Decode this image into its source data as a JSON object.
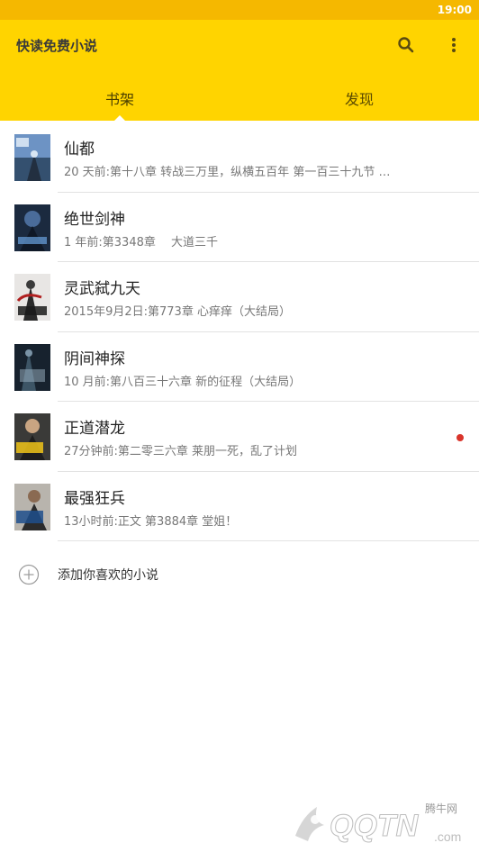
{
  "status_bar": {
    "time": "19:00"
  },
  "app": {
    "title": "快读免费小说",
    "search_icon": "search-icon",
    "more_icon": "more-vert-icon",
    "accent": "#ffd400",
    "status_color": "#f5b800"
  },
  "tabs": [
    {
      "label": "书架",
      "active": true
    },
    {
      "label": "发现",
      "active": false
    }
  ],
  "books": [
    {
      "title": "仙都",
      "subtitle": "20 天前:第十八章 转战三万里，纵横五百年 第一百三十九节 …",
      "has_update": false
    },
    {
      "title": "绝世剑神",
      "subtitle": "1 年前:第3348章　 大道三千",
      "has_update": false
    },
    {
      "title": "灵武弑九天",
      "subtitle": "2015年9月2日:第773章 心痒痒（大结局）",
      "has_update": false
    },
    {
      "title": "阴间神探",
      "subtitle": "10 月前:第八百三十六章 新的征程（大结局）",
      "has_update": false
    },
    {
      "title": "正道潜龙",
      "subtitle": "27分钟前:第二零三六章 莱朋一死，乱了计划",
      "has_update": true
    },
    {
      "title": "最强狂兵",
      "subtitle": "13小时前:正文 第3884章 堂姐！",
      "has_update": false
    }
  ],
  "add_row": {
    "label": "添加你喜欢的小说",
    "icon": "add-circle-icon"
  },
  "watermark": {
    "brand": "QQTN",
    "domain": ".com",
    "cn": "腾牛网"
  }
}
